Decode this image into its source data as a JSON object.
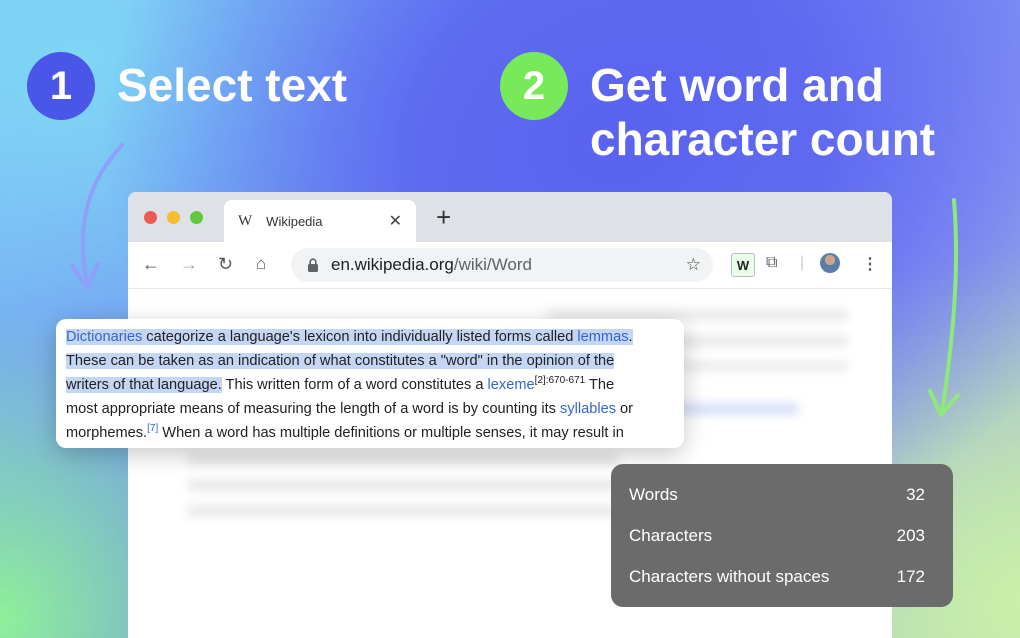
{
  "steps": [
    {
      "number": "1",
      "title": "Select text"
    },
    {
      "number": "2",
      "title": "Get word and character count"
    }
  ],
  "browser": {
    "tab_title": "Wikipedia",
    "tab_favicon": "W",
    "url_host": "en.wikipedia.org",
    "url_path": "/wiki/Word",
    "extension_label": "W"
  },
  "article": {
    "seg1_link": "Dictionaries",
    "seg1_text": " categorize a language's lexicon into individually listed forms called ",
    "seg1_link2": "lemmas",
    "seg1_end": ".",
    "seg2_text": "These can be taken as an indication of what constitutes a \"word\" in the opinion of the",
    "seg3_text": "writers of that language.",
    "seg4_text": " This written form of a word constitutes a ",
    "seg4_link": "lexeme",
    "seg4_ref": "[2]:670-671",
    "seg4_end": " The",
    "seg5_text": "most appropriate means of measuring the length of a word is by counting its ",
    "seg5_link": "syllables",
    "seg5_end": " or",
    "seg6_text": "morphemes.",
    "seg6_ref": "[7]",
    "seg6_end": " When a word has multiple definitions or multiple senses, it may result in"
  },
  "counts": [
    {
      "label": "Words",
      "value": "32"
    },
    {
      "label": "Characters",
      "value": "203"
    },
    {
      "label": "Characters without spaces",
      "value": "172"
    }
  ],
  "colors": {
    "step1_badge": "#4a56e8",
    "step2_badge": "#78ea5a",
    "selection": "#c5d6f5",
    "link": "#3366cc"
  }
}
